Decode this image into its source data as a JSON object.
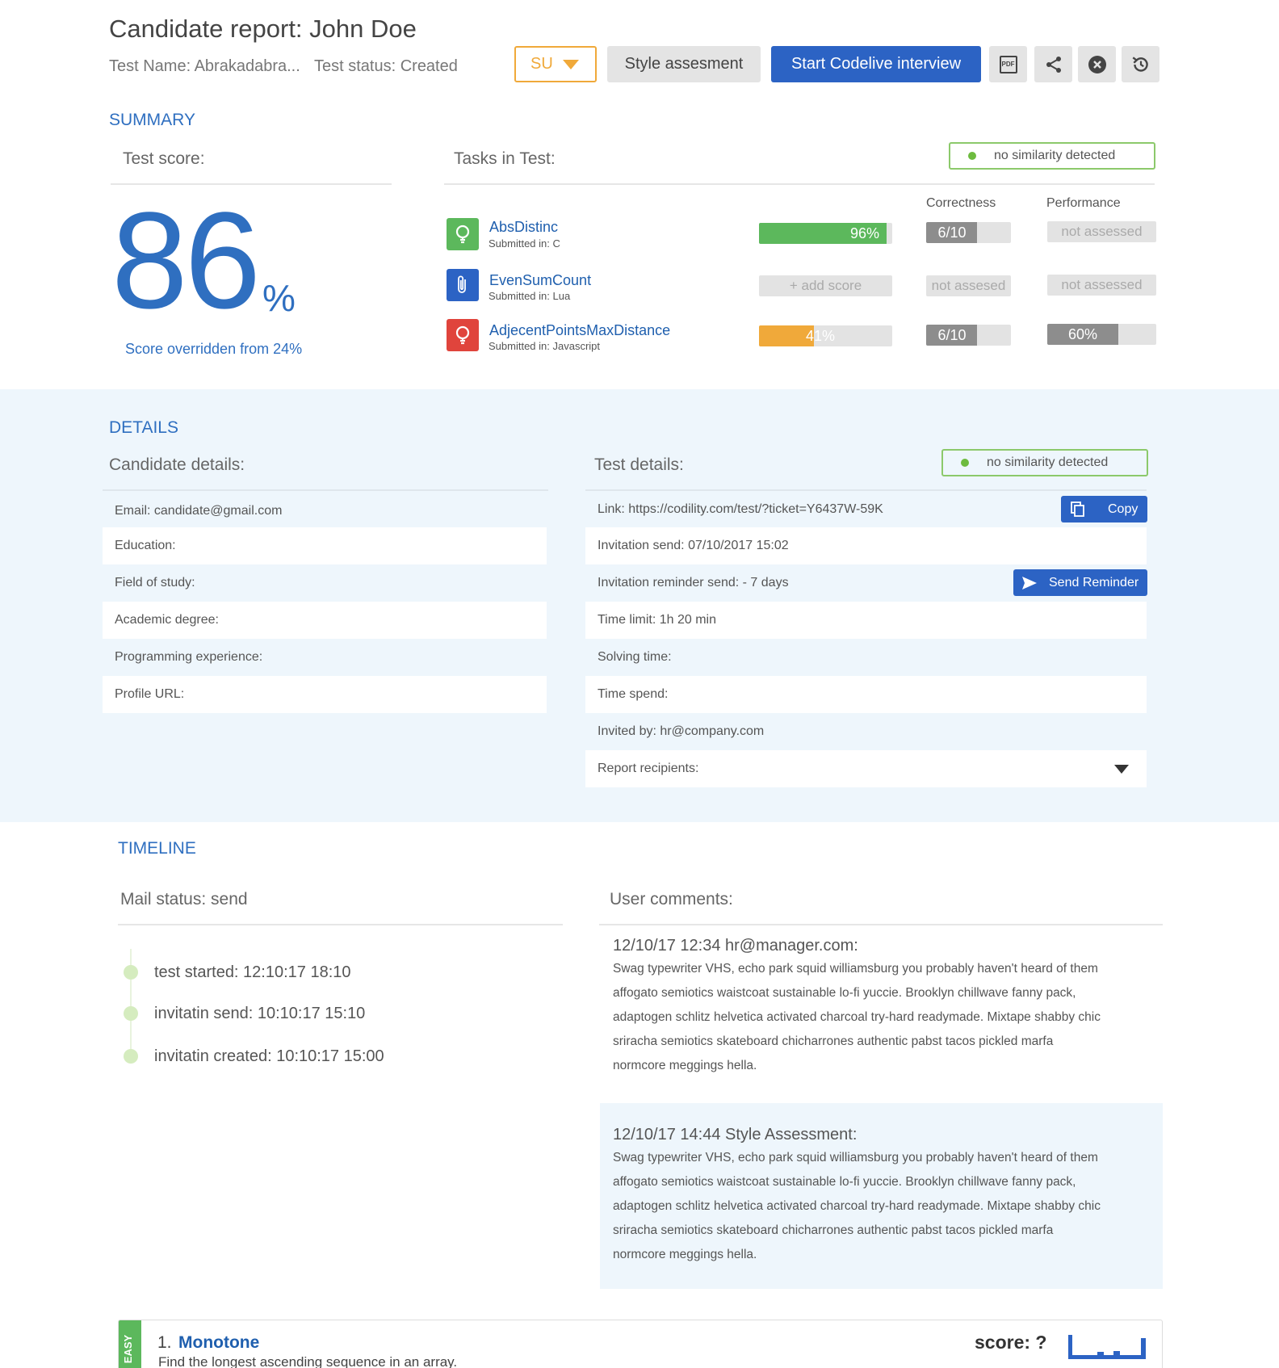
{
  "header": {
    "title": "Candidate report: John Doe",
    "test_name": "Test Name: Abrakadabra...",
    "test_status": "Test status: Created",
    "su_select": "SU",
    "style_button": "Style assesment",
    "start_button": "Start Codelive interview",
    "pdf_icon_text": "PDF"
  },
  "summary": {
    "label": "SUMMARY",
    "test_score_label": "Test score:",
    "score_value": "86",
    "score_unit": "%",
    "override_note": "Score overridden from 24%",
    "tasks_label": "Tasks in Test:",
    "similarity": "no similarity detected",
    "col_correctness": "Correctness",
    "col_performance": "Performance",
    "tasks": [
      {
        "name": "AbsDistinc",
        "submitted": "Submitted in: C",
        "score": "96%",
        "score_pct": 96,
        "score_color": "#5cb85c",
        "correctness": "6/10",
        "correctness_frac": 0.6,
        "performance": "not assessed",
        "icon": "lightbulb-icon",
        "icon_color": "#5cb85c"
      },
      {
        "name": "EvenSumCount",
        "submitted": "Submitted in: Lua",
        "score": "+ add  score",
        "correctness": "not assesed",
        "performance": "not assessed",
        "icon": "paperclip-icon",
        "icon_color": "#2c63c4"
      },
      {
        "name": "AdjecentPointsMaxDistance",
        "submitted": "Submitted in: Javascript",
        "score": "41%",
        "score_pct": 41,
        "score_color": "#f0a93a",
        "correctness": "6/10",
        "correctness_frac": 0.6,
        "performance": "60%",
        "performance_pct": 60,
        "icon": "lightbulb-icon",
        "icon_color": "#e0443c"
      }
    ]
  },
  "details": {
    "label": "DETAILS",
    "candidate_label": "Candidate details:",
    "candidate_rows": [
      "Email: candidate@gmail.com",
      "Education:",
      "Field of study:",
      "Academic degree:",
      "Programming experience:",
      "Profile URL:"
    ],
    "test_label": "Test details:",
    "similarity": "no similarity detected",
    "test_rows": [
      "Link: https://codility.com/test/?ticket=Y6437W-59K",
      "Invitation send: 07/10/2017 15:02",
      "Invitation reminder send: - 7 days",
      "Time limit: 1h 20 min",
      "Solving time:",
      "Time spend:",
      "Invited by: hr@company.com",
      "Report recipients:"
    ],
    "copy_button": "Copy",
    "reminder_button": "Send Reminder"
  },
  "timeline": {
    "label": "TIMELINE",
    "mail_status": "Mail status: send",
    "events": [
      "test started: 12:10:17 18:10",
      "invitatin send: 10:10:17 15:10",
      "invitatin created: 10:10:17 15:00"
    ],
    "comments_label": "User comments:",
    "comments": [
      {
        "header": "12/10/17 12:34 hr@manager.com:",
        "body": "Swag typewriter VHS, echo park squid williamsburg you probably haven't heard of them affogato semiotics waistcoat sustainable lo-fi yuccie. Brooklyn chillwave fanny pack, adaptogen schlitz helvetica activated charcoal try-hard readymade. Mixtape shabby chic sriracha semiotics skateboard chicharrones authentic pabst tacos pickled marfa normcore meggings hella."
      },
      {
        "header": "12/10/17 14:44 Style Assessment:",
        "body": "Swag typewriter VHS, echo park squid williamsburg you probably haven't heard of them affogato semiotics waistcoat sustainable lo-fi yuccie. Brooklyn chillwave fanny pack, adaptogen schlitz helvetica activated charcoal try-hard readymade. Mixtape shabby chic sriracha semiotics skateboard chicharrones authentic pabst tacos pickled marfa normcore meggings hella."
      }
    ]
  },
  "task_card": {
    "difficulty": "EASY",
    "number": "1.",
    "name": "Monotone",
    "description": "Find the longest ascending sequence in an array.",
    "score": "score: ?"
  }
}
